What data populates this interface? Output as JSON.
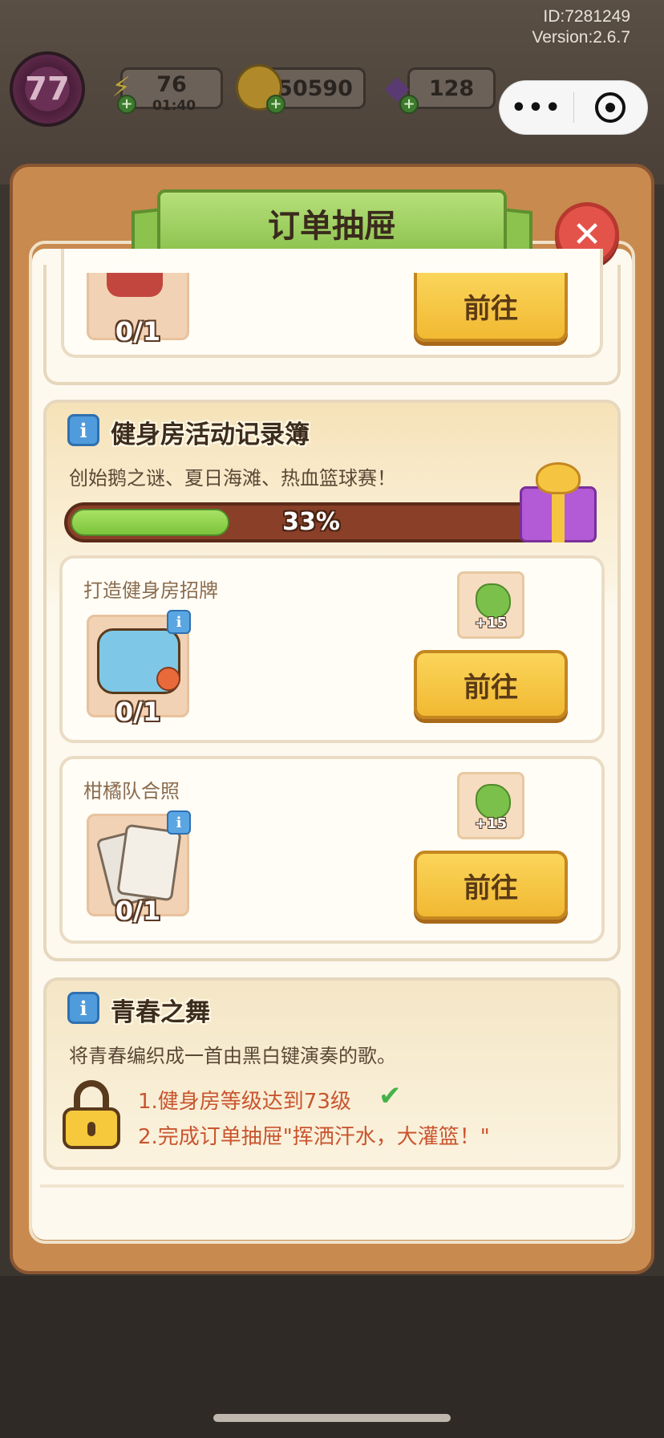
{
  "system": {
    "id_label": "ID:7281249",
    "version_label": "Version:2.6.7"
  },
  "hud": {
    "level": "77",
    "energy": "76",
    "energy_timer": "01:40",
    "coins": "50590",
    "gems": "128"
  },
  "miniapp": {
    "more_icon": "more-dots-icon",
    "close_icon": "target-circle-icon"
  },
  "modal": {
    "title": "订单抽屉",
    "close_icon": "close-x-icon"
  },
  "top_partial_card": {
    "count": "0/1",
    "go_label": "前往"
  },
  "gym_section": {
    "title": "健身房活动记录簿",
    "description": "创始鹅之谜、夏日海滩、热血篮球赛！",
    "progress_percent": 33,
    "progress_label": "33%",
    "tasks": [
      {
        "title": "打造健身房招牌",
        "count": "0/1",
        "reward": "+15",
        "go_label": "前往",
        "item_icon": "gym-sign-icon"
      },
      {
        "title": "柑橘队合照",
        "count": "0/1",
        "reward": "+15",
        "go_label": "前往",
        "item_icon": "photo-cards-icon"
      }
    ]
  },
  "youth_section": {
    "title": "青春之舞",
    "description": "将青春编织成一首由黑白键演奏的歌。",
    "conditions": [
      {
        "text": "1.健身房等级达到73级",
        "done": true
      },
      {
        "text": "2.完成订单抽屉\"挥洒汗水，大灌篮！\"",
        "done": false
      }
    ]
  },
  "colors": {
    "frame": "#c88a4f",
    "banner_green": "#8cc24e",
    "button_yellow": "#f1b932",
    "progress_green": "#7cc43a",
    "progress_track": "#8a3f28",
    "condition_red": "#c9552f",
    "check_green": "#46b24a",
    "info_blue": "#4f9bdc"
  }
}
